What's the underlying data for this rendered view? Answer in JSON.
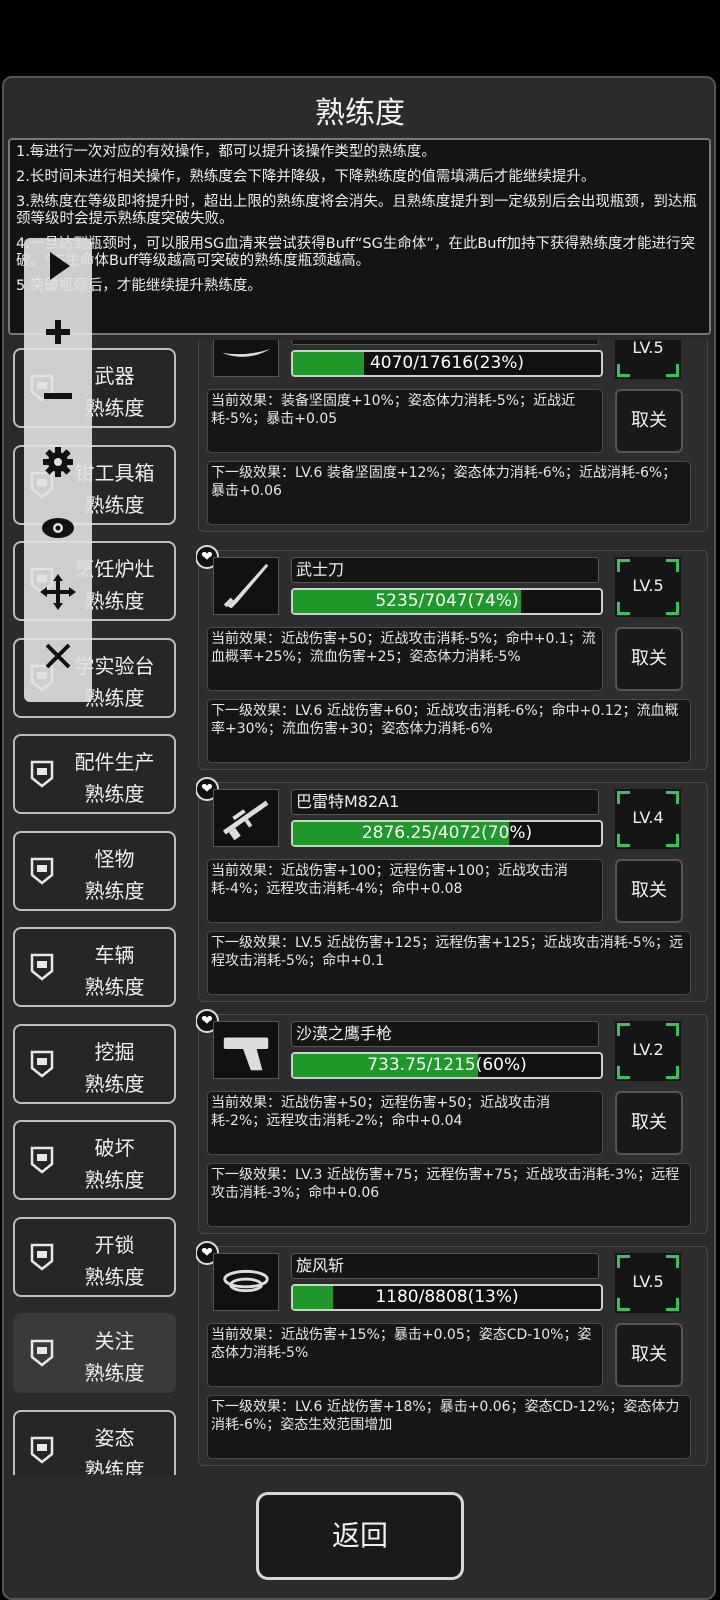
{
  "title": "熟练度",
  "help_lines": [
    "1.每进行一次对应的有效操作，都可以提升该操作类型的熟练度。",
    "2.长时间未进行相关操作，熟练度会下降并降级，下降熟练度的值需填满后才能继续提升。",
    "3.熟练度在等级即将提升时，超出上限的熟练度将会消失。且熟练度提升到一定级别后会出现瓶颈，到达瓶颈等级时会提示熟练度突破失败。",
    "4.一旦达到瓶颈时，可以服用SG血清来尝试获得Buff“SG生命体”，在此Buff加持下获得熟练度才能进行突破。SG生命体Buff等级越高可突破的熟练度瓶颈越高。",
    "5.突破瓶颈后，才能继续提升熟练度。"
  ],
  "categories": [
    {
      "l1": "武器",
      "l2": "熟练度"
    },
    {
      "l1": "钳工具箱",
      "l2": "熟练度"
    },
    {
      "l1": "烹饪炉灶",
      "l2": "熟练度"
    },
    {
      "l1": "学实验台",
      "l2": "熟练度"
    },
    {
      "l1": "配件生产",
      "l2": "熟练度"
    },
    {
      "l1": "怪物",
      "l2": "熟练度"
    },
    {
      "l1": "车辆",
      "l2": "熟练度"
    },
    {
      "l1": "挖掘",
      "l2": "熟练度"
    },
    {
      "l1": "破坏",
      "l2": "熟练度"
    },
    {
      "l1": "开锁",
      "l2": "熟练度"
    },
    {
      "l1": "关注",
      "l2": "熟练度",
      "selected": true
    },
    {
      "l1": "姿态",
      "l2": "熟练度"
    }
  ],
  "items": [
    {
      "name": "",
      "progress": "4070/17616(23%)",
      "pct": 23,
      "level": "LV.5",
      "current": "当前效果：装备坚固度+10%；姿态体力消耗-5%；近战近耗-5%；暴击+0.05",
      "next": "下一级效果：LV.6 装备坚固度+12%；姿态体力消耗-6%；近战消耗-6%；暴击+0.06",
      "action": "取关",
      "icon": "blade-icon"
    },
    {
      "name": "武士刀",
      "progress": "5235/7047(74%)",
      "pct": 74,
      "level": "LV.5",
      "current": "当前效果：近战伤害+50；近战攻击消耗-5%；命中+0.1；流血概率+25%；流血伤害+25；姿态体力消耗-5%",
      "next": "下一级效果：LV.6 近战伤害+60；近战攻击消耗-6%；命中+0.12；流血概率+30%；流血伤害+30；姿态体力消耗-6%",
      "action": "取关",
      "icon": "katana-icon"
    },
    {
      "name": "巴雷特M82A1",
      "progress": "2876.25/4072(70%)",
      "pct": 70,
      "level": "LV.4",
      "current": "当前效果：近战伤害+100；远程伤害+100；近战攻击消耗-4%；远程攻击消耗-4%；命中+0.08",
      "next": "下一级效果：LV.5 近战伤害+125；远程伤害+125；近战攻击消耗-5%；远程攻击消耗-5%；命中+0.1",
      "action": "取关",
      "icon": "sniper-rifle-icon"
    },
    {
      "name": "沙漠之鹰手枪",
      "progress": "733.75/1215(60%)",
      "pct": 60,
      "level": "LV.2",
      "current": "当前效果：近战伤害+50；远程伤害+50；近战攻击消耗-2%；远程攻击消耗-2%；命中+0.04",
      "next": "下一级效果：LV.3 近战伤害+75；远程伤害+75；近战攻击消耗-3%；远程攻击消耗-3%；命中+0.06",
      "action": "取关",
      "icon": "pistol-icon"
    },
    {
      "name": "旋风斩",
      "progress": "1180/8808(13%)",
      "pct": 13,
      "level": "LV.5",
      "current": "当前效果：近战伤害+15%；暴击+0.05；姿态CD-10%；姿态体力消耗-5%",
      "next": "下一级效果：LV.6 近战伤害+18%；暴击+0.06；姿态CD-12%；姿态体力消耗-6%；姿态生效范围增加",
      "action": "取关",
      "icon": "whirlwind-icon"
    }
  ],
  "back_label": "返回",
  "overlay_tools": [
    "play-icon",
    "plus-icon",
    "minus-icon",
    "gear-icon",
    "eye-icon",
    "move-icon",
    "close-icon"
  ]
}
